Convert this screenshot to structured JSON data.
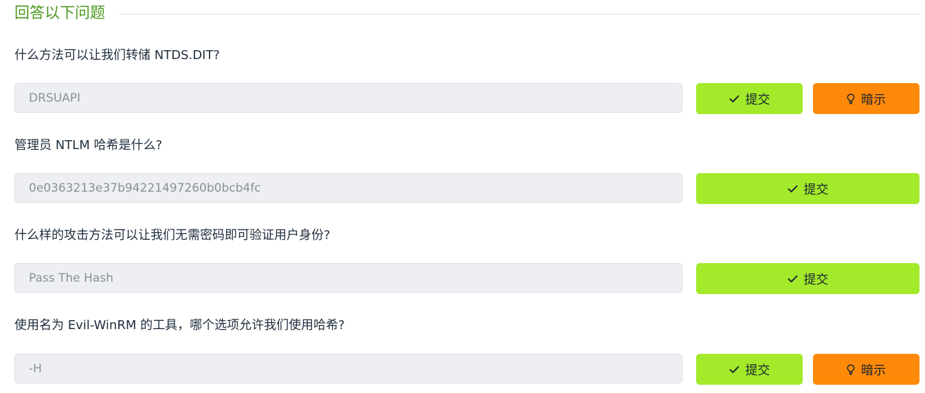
{
  "section": {
    "title": "回答以下问题"
  },
  "buttons": {
    "submit_label": "提交",
    "hint_label": "暗示"
  },
  "questions": [
    {
      "text": "什么方法可以让我们转储 NTDS.DIT?",
      "answer_value": "DRSUAPI",
      "has_hint": true
    },
    {
      "text": "管理员 NTLM 哈希是什么?",
      "answer_value": "0e0363213e37b94221497260b0bcb4fc",
      "has_hint": false
    },
    {
      "text": "什么样的攻击方法可以让我们无需密码即可验证用户身份?",
      "answer_value": "Pass The Hash",
      "has_hint": false
    },
    {
      "text": "使用名为 Evil-WinRM 的工具，哪个选项允许我们使用哈希?",
      "answer_value": "-H",
      "has_hint": true
    }
  ],
  "colors": {
    "title_green": "#4c9a1f",
    "submit_green": "#a3ea2a",
    "hint_orange": "#ff8a0a",
    "input_bg": "#edeff3"
  },
  "icons": {
    "submit": "check-icon",
    "hint": "lightbulb-icon"
  }
}
